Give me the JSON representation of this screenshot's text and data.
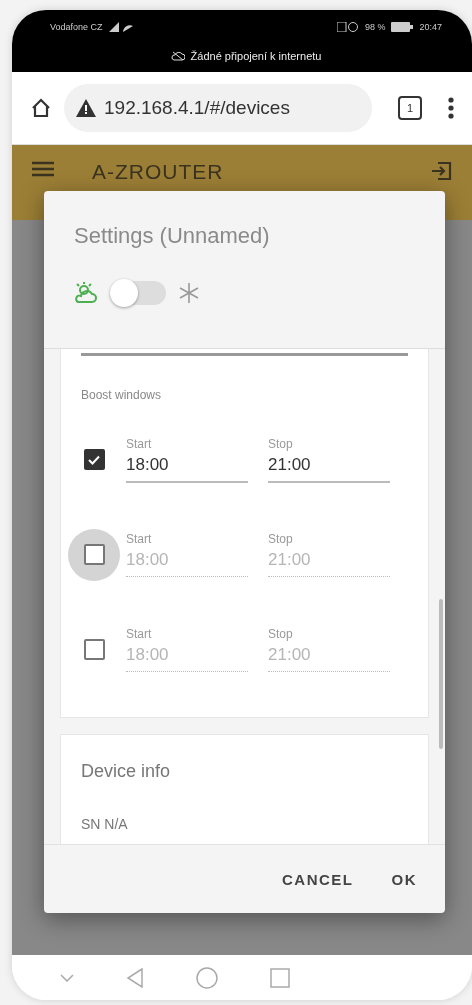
{
  "status_bar": {
    "carrier": "Vodafone CZ",
    "battery": "98 %",
    "time": "20:47",
    "notice": "Žádné připojení k internetu"
  },
  "browser": {
    "url": "192.168.4.1/#/devices",
    "tab_count": "1"
  },
  "app_bar": {
    "title": "A-ZROUTER"
  },
  "dialog": {
    "title": "Settings (Unnamed)",
    "mode_switch": {
      "on": false
    },
    "boost": {
      "heading": "Boost windows",
      "windows": [
        {
          "checked": true,
          "focused": false,
          "start_label": "Start",
          "start": "18:00",
          "stop_label": "Stop",
          "stop": "21:00"
        },
        {
          "checked": false,
          "focused": true,
          "start_label": "Start",
          "start": "18:00",
          "stop_label": "Stop",
          "stop": "21:00"
        },
        {
          "checked": false,
          "focused": false,
          "start_label": "Start",
          "start": "18:00",
          "stop_label": "Stop",
          "stop": "21:00"
        }
      ]
    },
    "device_info": {
      "heading": "Device info",
      "lines": [
        "SN N/A"
      ]
    },
    "buttons": [
      "CANCEL",
      "OK"
    ]
  }
}
